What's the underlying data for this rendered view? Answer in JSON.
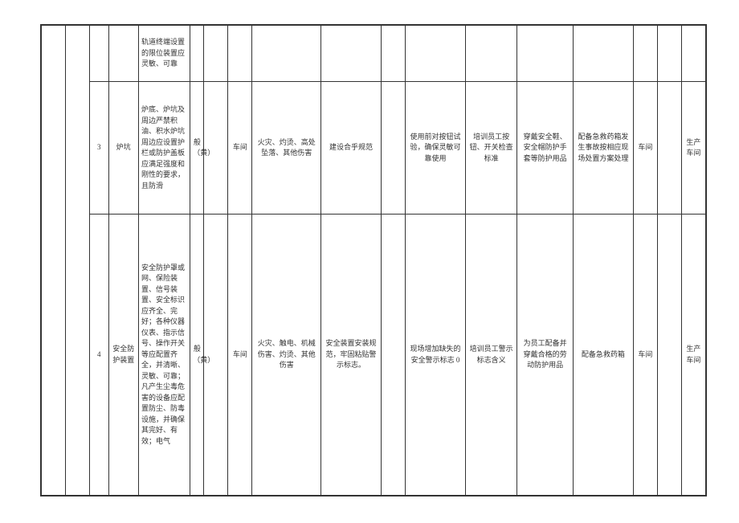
{
  "rows": [
    {
      "index": "",
      "name": "",
      "desc": "轨道终端设置的限位装置应灵敏、可靠",
      "level": "",
      "dept": "",
      "hazard": "",
      "eng": "",
      "ops": "",
      "train": "",
      "ppe": "",
      "emer": "",
      "dept2": "",
      "resp": ""
    },
    {
      "index": "3",
      "name": "炉坑",
      "desc": "炉底、炉坑及周边严禁积油、积水炉坑周边应设置护栏或防护盖板应满足强度和刚性的要求，且防滑",
      "level": "般（黄）",
      "dept": "车间",
      "hazard": "火灾、灼烫、高处坠落、其他伤害",
      "eng": "建设合乎规范",
      "ops": "使用前对按钮试验，确保灵敏可靠使用",
      "train": "培训员工按钮、开关检查标准",
      "ppe": "穿戴安全鞋、安全帽防护手套等防护用品",
      "emer": "配备急救药箱发生事故按相应现场处置方案处理",
      "dept2": "车间",
      "resp": "生产车间"
    },
    {
      "index": "4",
      "name": "安全防护装置",
      "desc": "安全防护罩或网、保险装置、信号装置、安全标识应齐全、完好；各种仪器仪表、指示信号、操作开关等应配置齐全，并清晰、灵敏、可靠；凡产生尘毒危害的设备应配置防尘、防毒设施，并确保其完好、有效；电气",
      "level": "般（黄）",
      "dept": "车间",
      "hazard": "火灾、触电、机械伤害、灼烫、其他伤害",
      "eng": "安全装置安装规范，牢固粘贴警示标志。",
      "ops": "现场增加缺失的安全警示标志 0",
      "train": "培训员工警示标志含义",
      "ppe": "为员工配备并穿戴合格的劳动防护用品",
      "emer": "配备急救药箱",
      "dept2": "车间",
      "resp": "生产车间"
    }
  ]
}
